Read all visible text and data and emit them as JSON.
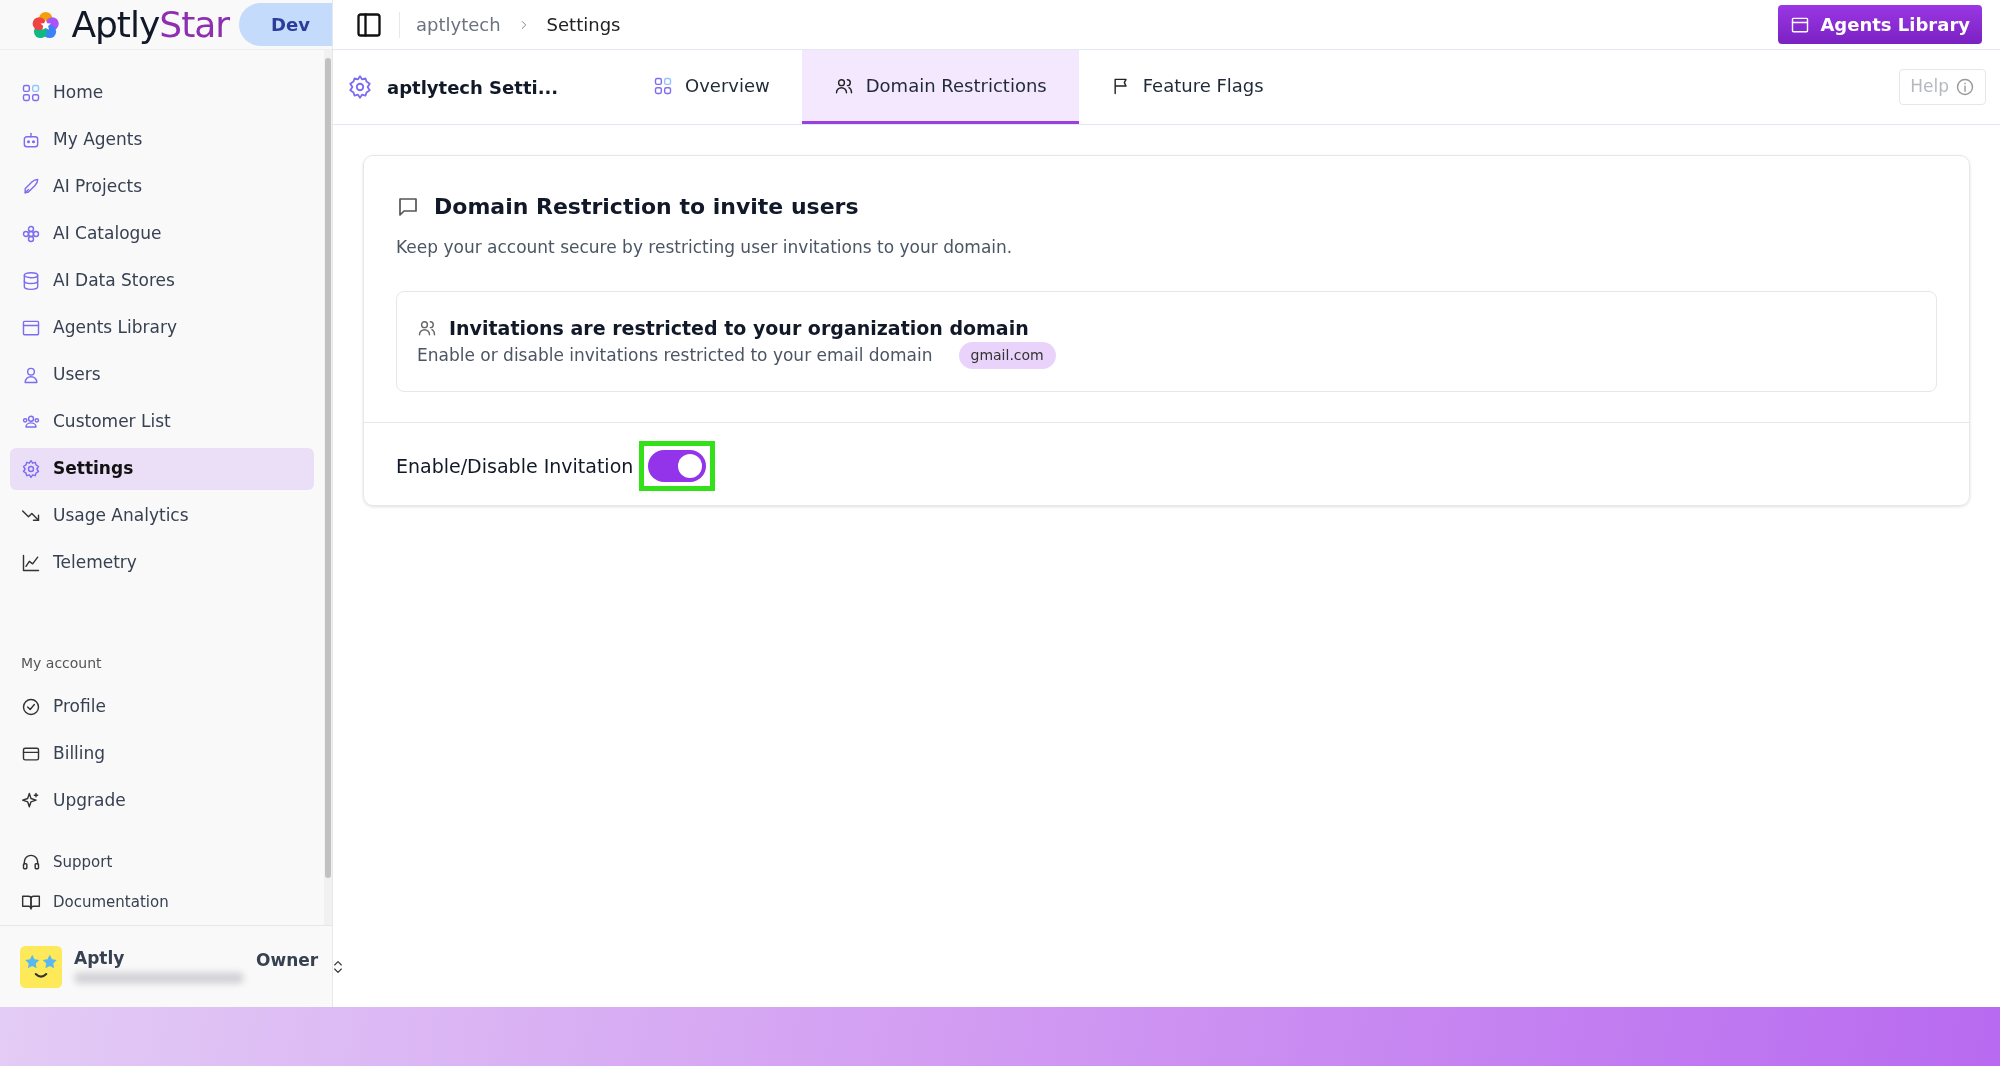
{
  "brand": {
    "name_part1": "Aptly",
    "name_part2": "Star",
    "env_badge": "Dev"
  },
  "breadcrumb": [
    {
      "label": "aptlytech",
      "selected": false
    },
    {
      "label": "Settings",
      "selected": true
    }
  ],
  "header_button": "Agents Library",
  "sidebar": {
    "items": [
      {
        "label": "Home",
        "selected": false
      },
      {
        "label": "My Agents",
        "selected": false
      },
      {
        "label": "AI Projects",
        "selected": false
      },
      {
        "label": "AI Catalogue",
        "selected": false
      },
      {
        "label": "AI Data Stores",
        "selected": false
      },
      {
        "label": "Agents Library",
        "selected": false
      },
      {
        "label": "Users",
        "selected": false
      },
      {
        "label": "Customer List",
        "selected": false
      },
      {
        "label": "Settings",
        "selected": true
      },
      {
        "label": "Usage Analytics",
        "selected": false
      },
      {
        "label": "Telemetry",
        "selected": false
      }
    ],
    "account_heading": "My account",
    "account_items": [
      {
        "label": "Profile"
      },
      {
        "label": "Billing"
      },
      {
        "label": "Upgrade"
      }
    ],
    "footer_items": [
      {
        "label": "Support"
      },
      {
        "label": "Documentation"
      }
    ],
    "user": {
      "name": "Aptly",
      "role": "Owner"
    }
  },
  "page_title": "aptlytech Setti...",
  "tabs": [
    {
      "label": "Overview",
      "selected": false
    },
    {
      "label": "Domain Restrictions",
      "selected": true
    },
    {
      "label": "Feature Flags",
      "selected": false
    }
  ],
  "help_button": "Help",
  "card": {
    "title": "Domain Restriction to invite users",
    "description": "Keep your account secure by restricting user invitations to your domain.",
    "info": {
      "title": "Invitations are restricted to your organization domain",
      "text": "Enable or disable invitations restricted to your email domain",
      "domain": "gmail.com"
    },
    "toggle": {
      "label": "Enable/Disable Invitation",
      "on": true,
      "highlighted": true
    }
  }
}
